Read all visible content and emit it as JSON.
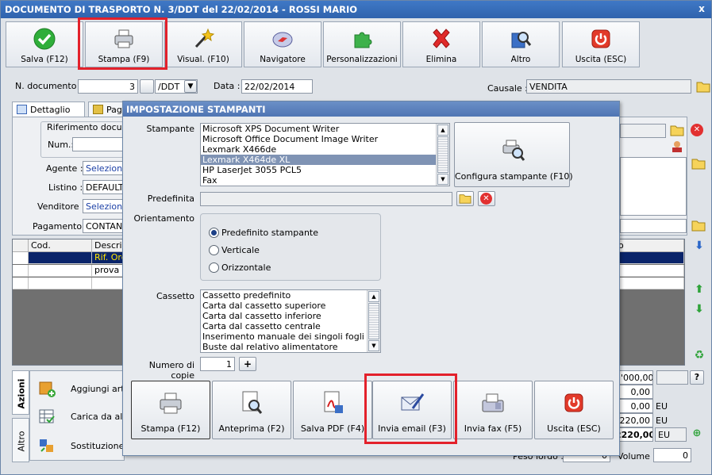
{
  "window": {
    "title": "DOCUMENTO DI TRASPORTO N. 3/DDT del 22/02/2014 - ROSSI MARIO",
    "close_glyph": "x"
  },
  "toolbar": [
    {
      "label": "Salva (F12)",
      "icon": "check-icon"
    },
    {
      "label": "Stampa (F9)",
      "icon": "printer-icon"
    },
    {
      "label": "Visual. (F10)",
      "icon": "magic-wand-icon"
    },
    {
      "label": "Navigatore",
      "icon": "compass-icon"
    },
    {
      "label": "Personalizzazioni",
      "icon": "puzzle-icon"
    },
    {
      "label": "Elimina",
      "icon": "delete-x-icon"
    },
    {
      "label": "Altro",
      "icon": "magnifier-book-icon"
    },
    {
      "label": "Uscita (ESC)",
      "icon": "power-icon"
    }
  ],
  "header": {
    "n_documento_label": "N. documento :",
    "n_documento_value": "3",
    "serie_value": "/DDT",
    "data_label": "Data :",
    "data_value": "22/02/2014",
    "causale_label": "Causale :",
    "causale_value": "VENDITA"
  },
  "tabs": [
    {
      "label": "Dettaglio (F5)"
    },
    {
      "label": "Pag"
    }
  ],
  "detail": {
    "riferimento_label": "Riferimento docume",
    "num_label": "Num.:",
    "agente_label": "Agente :",
    "agente_value": "Seleziona",
    "listino_label": "Listino :",
    "listino_value": "DEFAULT",
    "venditore_label": "Venditore :",
    "venditore_value": "Seleziona",
    "pagamento_label": "Pagamento :",
    "pagamento_value": "CONTANT"
  },
  "grid": {
    "headers": [
      "Cod.",
      "Descrizi",
      "o"
    ],
    "rows": [
      {
        "cod": "",
        "desc": "Rif. Ord",
        "selected": true
      },
      {
        "cod": "",
        "desc": "prova",
        "selected": false
      },
      {
        "cod": "",
        "desc": "",
        "selected": false
      }
    ]
  },
  "side_tabs": [
    "Azioni",
    "Altro"
  ],
  "actions": [
    {
      "label": "Aggiungi artico",
      "icon": "add-box-icon"
    },
    {
      "label": "Carica da altr",
      "icon": "load-grid-icon"
    },
    {
      "label": "Sostituzione a",
      "icon": "replace-icon"
    }
  ],
  "totals": {
    "values": [
      "2'000,00",
      "0,00",
      "0,00",
      "220,00",
      "2220,00"
    ],
    "currency": [
      "",
      "",
      "EU",
      "EU",
      "EU"
    ],
    "help": "?",
    "peso_label": "Peso lordo :",
    "peso_value": "0",
    "volume_label": "Volume :",
    "volume_value": "0"
  },
  "dialog": {
    "title": "IMPOSTAZIONE STAMPANTI",
    "stampante_label": "Stampante",
    "printers": [
      "Microsoft XPS Document Writer",
      "Microsoft Office Document Image Writer",
      "Lexmark X466de",
      "Lexmark X464de XL",
      "HP LaserJet 3055 PCL5",
      "Fax"
    ],
    "selected_printer": 3,
    "configura_label": "Configura stampante (F10)",
    "predefinita_label": "Predefinita",
    "predefinita_value": "",
    "orientamento_label": "Orientamento",
    "orientations": [
      "Predefinito stampante",
      "Verticale",
      "Orizzontale"
    ],
    "selected_orientation": 0,
    "cassetto_label": "Cassetto",
    "trays": [
      "Cassetto predefinito",
      "Carta dal cassetto superiore",
      "Carta dal cassetto inferiore",
      "Carta dal cassetto centrale",
      "Inserimento manuale dei singoli fogli",
      "Buste dal relativo alimentatore"
    ],
    "copie_label": "Numero di copie",
    "copie_value": "1",
    "plus": "+",
    "buttons": [
      {
        "label": "Stampa (F12)",
        "icon": "printer-icon"
      },
      {
        "label": "Anteprima (F2)",
        "icon": "preview-icon"
      },
      {
        "label": "Salva PDF (F4)",
        "icon": "pdf-icon"
      },
      {
        "label": "Invia email (F3)",
        "icon": "email-icon"
      },
      {
        "label": "Invia fax (F5)",
        "icon": "fax-icon"
      },
      {
        "label": "Uscita (ESC)",
        "icon": "power-icon"
      }
    ]
  },
  "colors": {
    "titlebar": "#3f78c6",
    "highlight_box": "#e3212b",
    "grid_selection": "#0a246a"
  }
}
